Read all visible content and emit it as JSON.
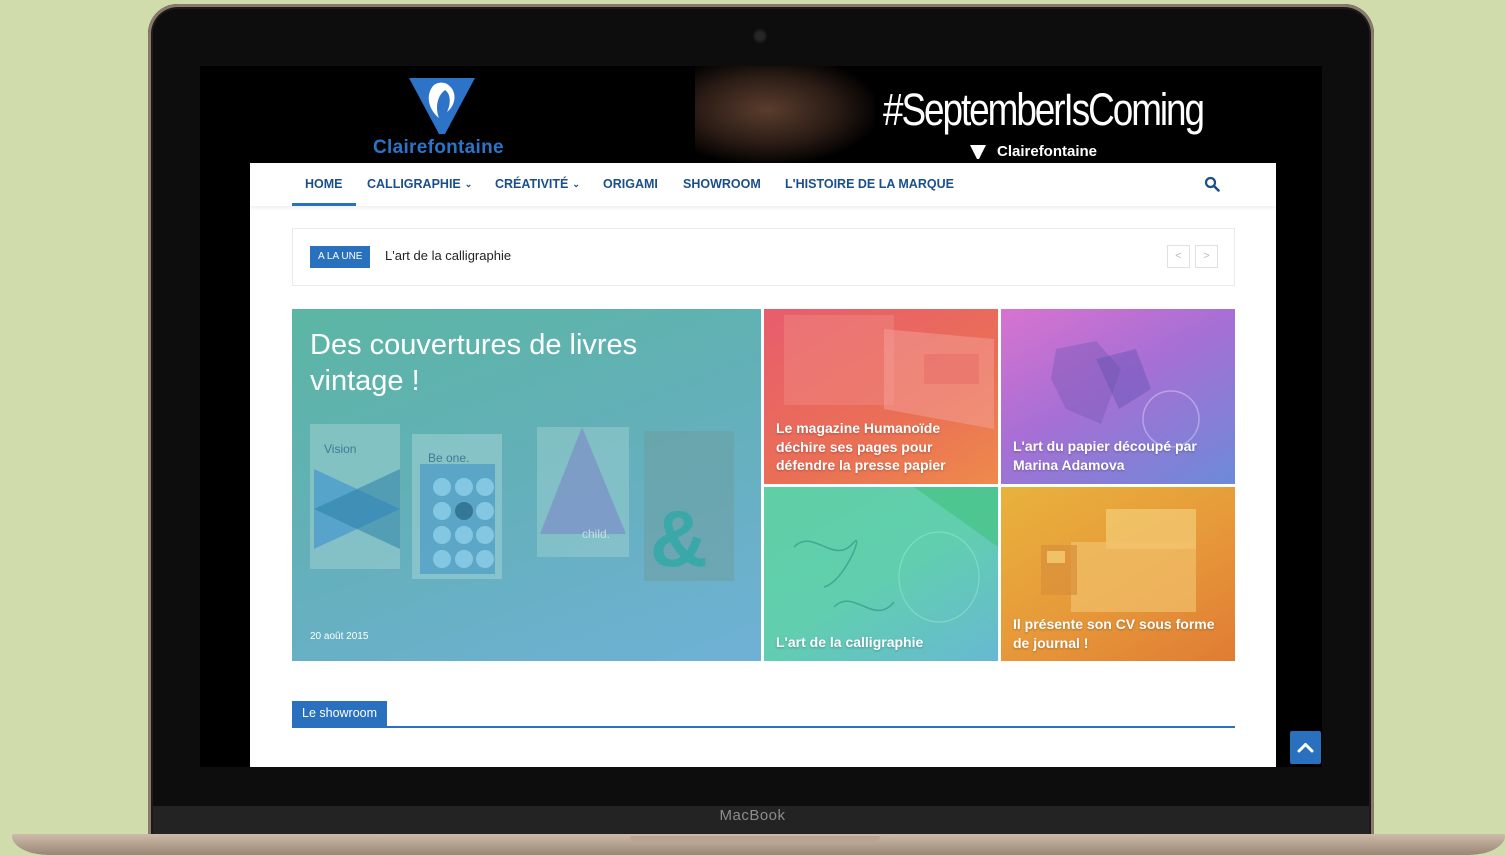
{
  "banner": {
    "logo_text": "Clairefontaine",
    "hashtag": "#SeptemberIsComing",
    "brand": "Clairefontaine"
  },
  "nav": {
    "items": [
      {
        "label": "HOME",
        "active": true
      },
      {
        "label": "CALLIGRAPHIE",
        "dropdown": true
      },
      {
        "label": "CRÉATIVITÉ",
        "dropdown": true
      },
      {
        "label": "ORIGAMI"
      },
      {
        "label": "SHOWROOM"
      },
      {
        "label": "L'HISTOIRE DE LA MARQUE"
      }
    ],
    "search_icon": "search-icon"
  },
  "ticker": {
    "badge": "A LA UNE",
    "text": "L'art de la calligraphie",
    "prev": "<",
    "next": ">"
  },
  "featured": {
    "main": {
      "title": "Des couvertures de livres vintage !",
      "date": "20 août 2015",
      "art": {
        "vision": "Vision",
        "beone": "Be one.",
        "child": "child.",
        "amp": "&"
      }
    },
    "tiles": [
      {
        "title": "Le magazine Humanoïde déchire ses pages pour défendre la presse papier"
      },
      {
        "title": "L'art du papier découpé par Marina Adamova"
      },
      {
        "title": "L'art de la calligraphie"
      },
      {
        "title": "Il présente son CV sous forme de journal !"
      }
    ]
  },
  "section": {
    "title": "Le showroom"
  },
  "laptop": {
    "label": "MacBook"
  },
  "colors": {
    "accent": "#2970be",
    "nav_text": "#1a4f8c",
    "background": "#d1dcad"
  }
}
